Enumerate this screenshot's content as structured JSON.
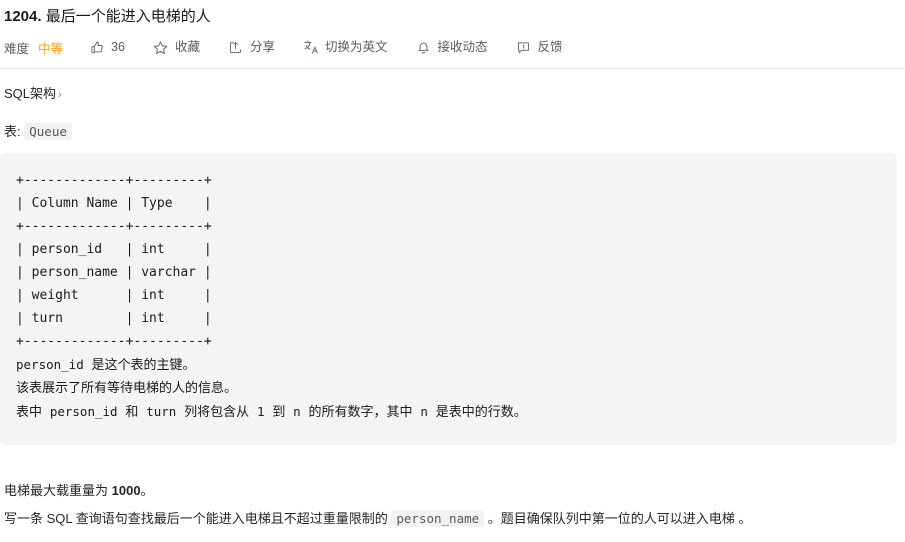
{
  "header": {
    "title_number": "1204.",
    "title_text": "最后一个能进入电梯的人"
  },
  "toolbar": {
    "difficulty_label": "难度",
    "difficulty_value": "中等",
    "difficulty_color": "#ffa116",
    "like_count": "36",
    "favorite_label": "收藏",
    "share_label": "分享",
    "translate_label": "切换为英文",
    "subscribe_label": "接收动态",
    "feedback_label": "反馈"
  },
  "schema": {
    "link_label": "SQL架构",
    "chevron": "›",
    "table_prefix": "表:",
    "table_name": "Queue"
  },
  "code_block": {
    "ascii_table": "+-------------+---------+\n| Column Name | Type    |\n+-------------+---------+\n| person_id   | int     |\n| person_name | varchar |\n| weight      | int     |\n| turn        | int     |\n+-------------+---------+",
    "note_line_1_code": "person_id",
    "note_line_1_text": " 是这个表的主键。",
    "note_line_2": "该表展示了所有等待电梯的人的信息。",
    "note_line_3_a": "表中 ",
    "note_line_3_code1": "person_id",
    "note_line_3_b": " 和 ",
    "note_line_3_code2": "turn",
    "note_line_3_c": " 列将包含从 ",
    "note_line_3_code3": "1",
    "note_line_3_d": " 到 ",
    "note_line_3_code4": "n",
    "note_line_3_e": " 的所有数字，其中 ",
    "note_line_3_code5": "n",
    "note_line_3_f": " 是表中的行数。"
  },
  "body": {
    "weight_prefix": "电梯最大载重量为 ",
    "weight_value": "1000",
    "weight_suffix": "。",
    "task_a": "写一条 SQL 查询语句查找最后一个能进入电梯且不超过重量限制的 ",
    "task_code": "person_name",
    "task_b": " 。题目确保队列中第一位的人可以进入电梯 。"
  },
  "colors": {
    "code_bg": "#f4f4f5",
    "inline_code_bg": "#f2f2f2",
    "divider": "#ebebeb",
    "text": "#262626",
    "muted": "#5c5c5c"
  }
}
